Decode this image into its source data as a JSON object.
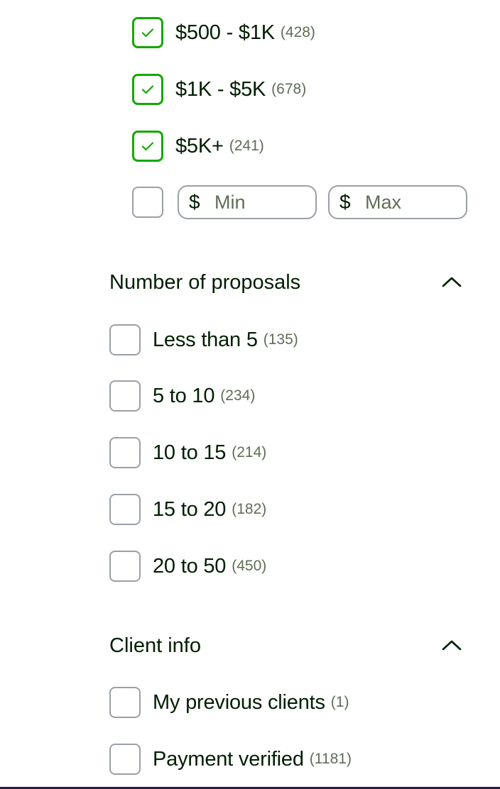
{
  "budget": {
    "options": [
      {
        "label": "$500 - $1K",
        "count": "(428)",
        "checked": true
      },
      {
        "label": "$1K - $5K",
        "count": "(678)",
        "checked": true
      },
      {
        "label": "$5K+",
        "count": "(241)",
        "checked": true
      }
    ],
    "custom": {
      "checked": false,
      "currency_symbol": "$",
      "min_placeholder": "Min",
      "max_placeholder": "Max"
    }
  },
  "proposals": {
    "title": "Number of proposals",
    "expanded": true,
    "options": [
      {
        "label": "Less than 5",
        "count": "(135)",
        "checked": false
      },
      {
        "label": "5 to 10",
        "count": "(234)",
        "checked": false
      },
      {
        "label": "10 to 15",
        "count": "(214)",
        "checked": false
      },
      {
        "label": "15 to 20",
        "count": "(182)",
        "checked": false
      },
      {
        "label": "20 to 50",
        "count": "(450)",
        "checked": false
      }
    ]
  },
  "client_info": {
    "title": "Client info",
    "expanded": true,
    "options": [
      {
        "label": "My previous clients",
        "count": "(1)",
        "checked": false
      },
      {
        "label": "Payment verified",
        "count": "(1181)",
        "checked": false
      }
    ]
  },
  "colors": {
    "checked_border": "#14a800",
    "checkmark": "#14a800",
    "unchecked_border": "#9aa0a6",
    "count_text": "#5e6d55",
    "text": "#001e00"
  },
  "icons": {
    "check": "check-icon",
    "collapse": "chevron-up-icon"
  }
}
